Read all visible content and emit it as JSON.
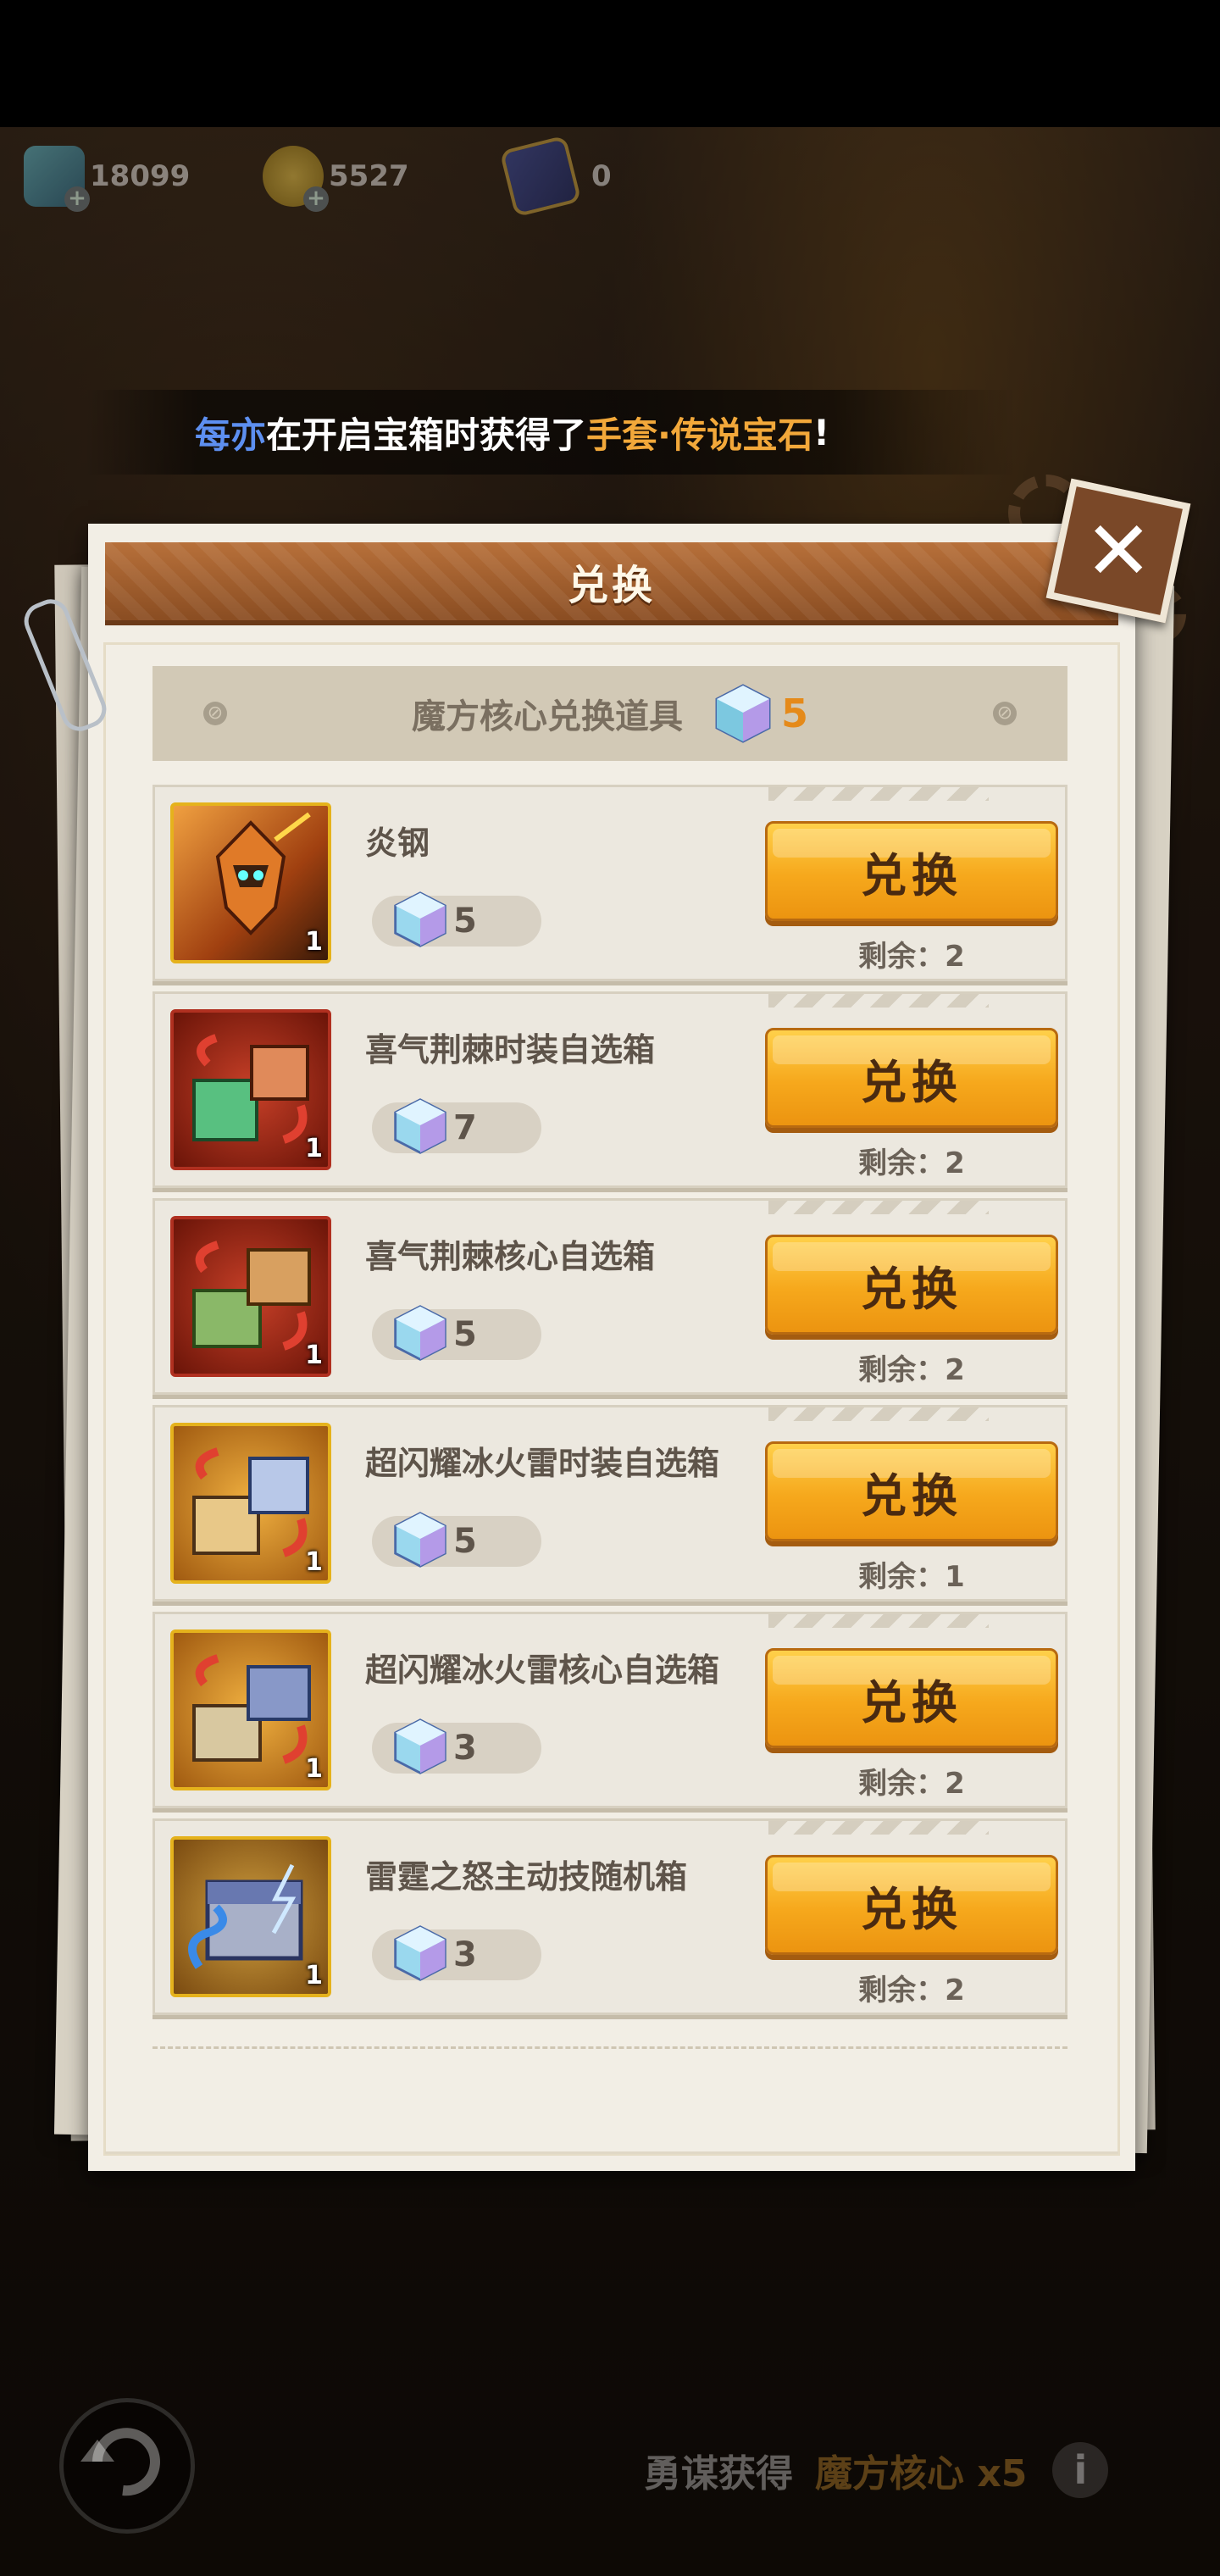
{
  "currencies": [
    {
      "icon": "diamond-icon",
      "value": "18099"
    },
    {
      "icon": "coin-icon",
      "value": "5527"
    },
    {
      "icon": "ticket-card-icon",
      "value": "0"
    }
  ],
  "notice": {
    "player": "每亦",
    "text1": "在开启宝箱时获得了",
    "item": "手套·传说宝石",
    "text2": "!"
  },
  "dialog": {
    "title": "兑换",
    "header_label": "魔方核心兑换道具",
    "header_count": "5",
    "items": [
      {
        "name": "炎钢",
        "cost": "5",
        "button": "兑换",
        "remain": "剩余：2",
        "qty": "1",
        "icon": "mecha-icon"
      },
      {
        "name": "喜气荆棘时装自选箱",
        "cost": "7",
        "button": "兑换",
        "remain": "剩余：2",
        "qty": "1",
        "icon": "gift-box-icon"
      },
      {
        "name": "喜气荆棘核心自选箱",
        "cost": "5",
        "button": "兑换",
        "remain": "剩余：2",
        "qty": "1",
        "icon": "core-box-icon"
      },
      {
        "name": "超闪耀冰火雷时装自选箱",
        "cost": "5",
        "button": "兑换",
        "remain": "剩余：1",
        "qty": "1",
        "icon": "gift-box-icon"
      },
      {
        "name": "超闪耀冰火雷核心自选箱",
        "cost": "3",
        "button": "兑换",
        "remain": "剩余：2",
        "qty": "1",
        "icon": "core-box-icon"
      },
      {
        "name": "雷霆之怒主动技随机箱",
        "cost": "3",
        "button": "兑换",
        "remain": "剩余：2",
        "qty": "1",
        "icon": "thunder-chest-icon"
      }
    ]
  },
  "footer": {
    "gain_label": "勇谋获得",
    "gain_item": "魔方核心 x5"
  },
  "colors": {
    "accent_orange": "#f6a81c",
    "title_brown": "#9a5a2a",
    "player_blue": "#5d8ff0",
    "item_orange": "#f2a83a"
  }
}
